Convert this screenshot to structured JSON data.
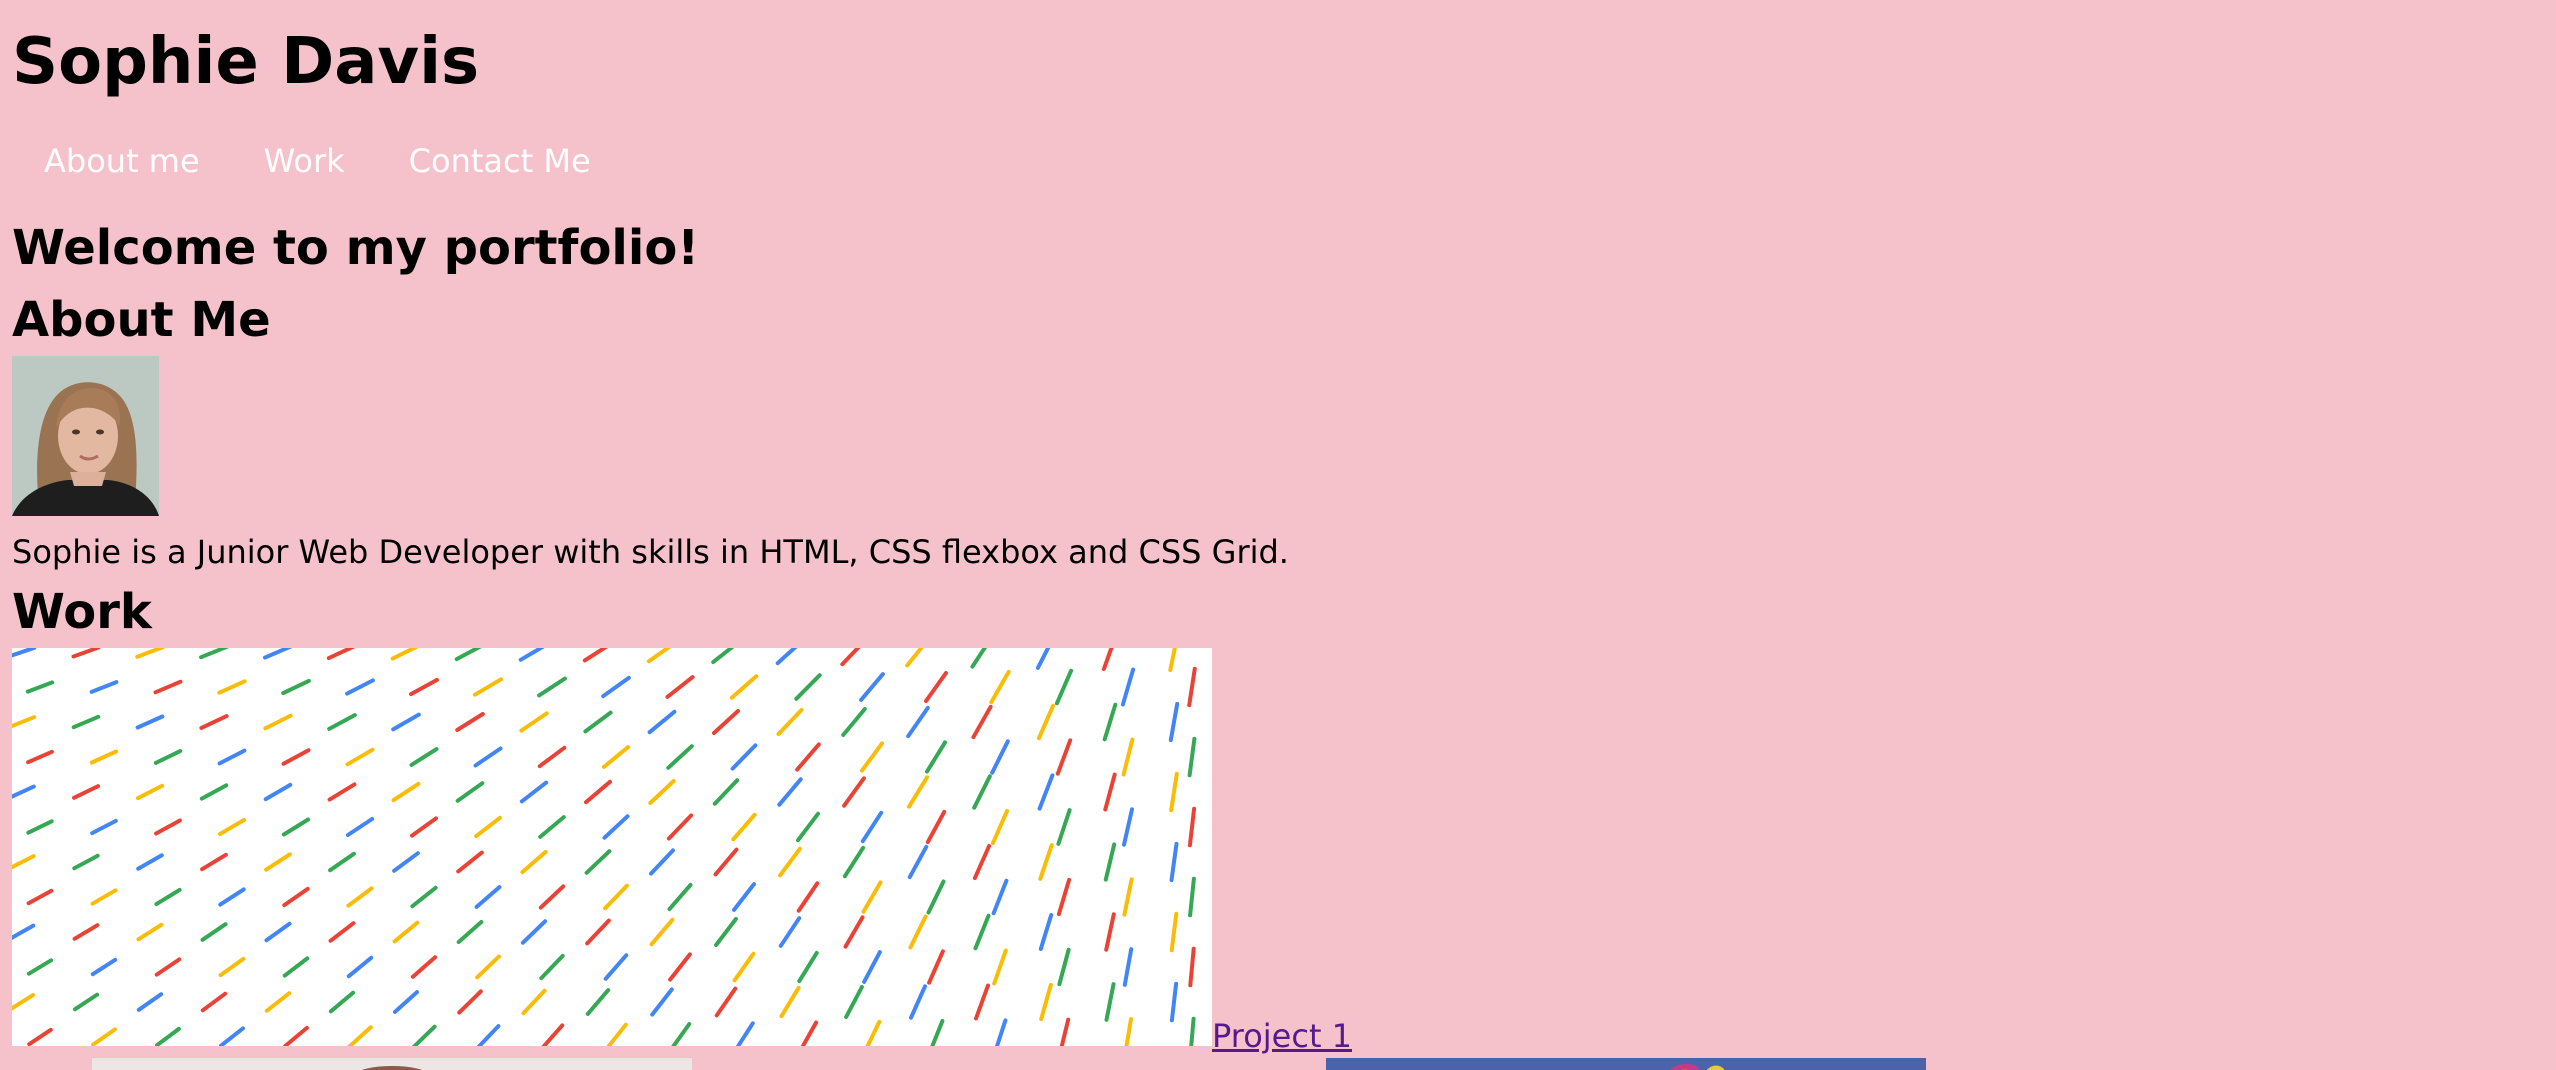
{
  "site": {
    "title": "Sophie Davis"
  },
  "nav": {
    "items": [
      {
        "label": "About me"
      },
      {
        "label": "Work"
      },
      {
        "label": "Contact Me"
      }
    ]
  },
  "main": {
    "welcome": "Welcome to my portfolio!",
    "about": {
      "heading": "About Me",
      "bio": "Sophie is a Junior Web Developer with skills in HTML, CSS flexbox and CSS Grid."
    },
    "work": {
      "heading": "Work",
      "project_link": "Project 1"
    }
  },
  "colors": {
    "background": "#f5c2cb",
    "nav_text": "#ffffff",
    "visited_link": "#551a8b",
    "pattern": [
      "#4285f4",
      "#ea4335",
      "#fbbc05",
      "#34a853"
    ]
  }
}
